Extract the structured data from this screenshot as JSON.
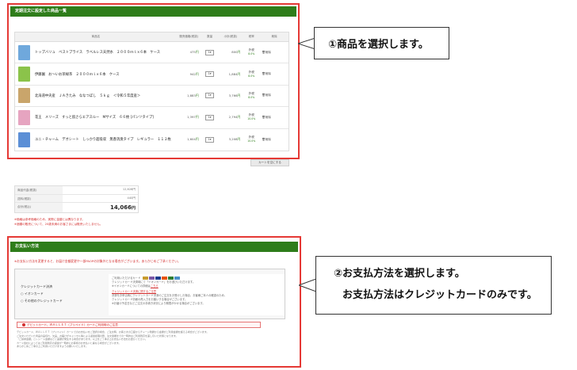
{
  "cart_section": {
    "title": "定期注文に設定した商品一覧",
    "headers": [
      "商品名",
      "販売価格(税抜)",
      "数量",
      "小計(税抜)",
      "税率",
      "削除"
    ],
    "items": [
      {
        "name": "トップバリュ　ベストプライス　ラベルレス天然水　２０００ｍｌ×６本　ケース",
        "unit_price": "475",
        "qty": "1",
        "subtotal": "800",
        "tax_type": "外税",
        "tax_rate": "8.0%",
        "delete": "削除",
        "img_color": "#6fa8dc"
      },
      {
        "name": "伊藤園　お～いお茶緑茶　２０００ｍｌ×６本　ケース",
        "unit_price": "942",
        "qty": "1",
        "subtotal": "1,884",
        "tax_type": "外税",
        "tax_rate": "8.0%",
        "delete": "削除",
        "img_color": "#8bc34a"
      },
      {
        "name": "北海道中央産　ＪＡきたみ　ななつぼし　５ｋｇ　＜令和５年度産＞",
        "unit_price": "1,883",
        "qty": "1",
        "subtotal": "3,766",
        "tax_type": "外税",
        "tax_rate": "8.0%",
        "delete": "削除",
        "img_color": "#c9a56b"
      },
      {
        "name": "花王　メリーズ　すっと肌さらエアスルー　Mサイズ　６６枚 [パンツタイプ]",
        "unit_price": "1,397",
        "qty": "1",
        "subtotal": "2,794",
        "tax_type": "外税",
        "tax_rate": "10.0%",
        "delete": "削除",
        "img_color": "#e6a4c0"
      },
      {
        "name": "ユニ・チャーム　デオシート　しっかり超吸収　無香消臭タイプ　レギュラー　１１２枚",
        "unit_price": "1,604",
        "qty": "1",
        "subtotal": "3,208",
        "tax_type": "外税",
        "tax_rate": "10.0%",
        "delete": "削除",
        "img_color": "#5c8fd6"
      }
    ],
    "cart_button": "カートを空にする"
  },
  "totals": {
    "rows": [
      {
        "label": "商品代金(税抜)",
        "value": "12,628円"
      },
      {
        "label": "送料(税抜)",
        "value": "440円"
      },
      {
        "label": "合計(税込)",
        "value": "14,066"
      }
    ],
    "yen": "円",
    "notes": [
      "※価格は参考価格のため、実際に金額とは異なります。",
      "※酒類の販売について、20歳未満のお客さまには販売いたしません。"
    ]
  },
  "payment_section": {
    "title": "お支払い方法",
    "warning": "※お支払い方法を変更すると、お届け金額変更や一部PAOPの対象外となる場合がございます。あらかじめご了承ください。",
    "method_label": "クレジットカード決済",
    "options": [
      "イオンカード",
      "その他のクレジットカード"
    ],
    "card_info_title": "ご利用いただけるカード",
    "card_info_lines": [
      "クレジットカード決済時にて「イオンカード」をお選びいただけます。",
      "※イオンカードについての詳細は"
    ],
    "card_info_link": "こちら",
    "change_link": "クレジットカード決済に関するご注意",
    "change_text": [
      "決済をお申込時にクレジットカード決済のご注文をお受けした場合、お客様ご本人の確認のため、",
      "クレジットカード情報の再入力をお願いする場合がございます。",
      "※お届け予定日などご注文の手続き状況により期間がかかる場合がございます。"
    ],
    "notice": "デビットカード、ＷＡＬＬＥＴ（プリペイド）カードご利用時のご注意",
    "fine_print": [
      "デビットカード、ＷＡＬＬＥＴ（プリペイド）カードでのお支払いをご選択の場合、ご注文時、お客さまの口座からチャージ残額から金額がご利用金額を超える場合がございます。",
      "ご注文いただいた商品の品切れ、欠品、お届けがキャンセル等による返金処理の際、注文金額までの一時的なご利用残高を差し引いた状態となります。",
      "「ご請求金額」とレシート金額などと差額が発生する場合があります。以上をご了承の上お支払い方法をお選びください。",
      "カード会社によってはご利用残高の返金が一時的にお客様のお支払いと異なる場合がございます。",
      "あらかじめご了承の上ご利用いただけますようお願いいたします。"
    ]
  },
  "callouts": {
    "step1": "①商品を選択します。",
    "step2_line1": "②お支払方法を選択します。",
    "step2_line2": "お支払方法はクレジットカードのみです。"
  },
  "colors": {
    "accent_green": "#2e7d1a",
    "highlight_red": "#e53935"
  }
}
